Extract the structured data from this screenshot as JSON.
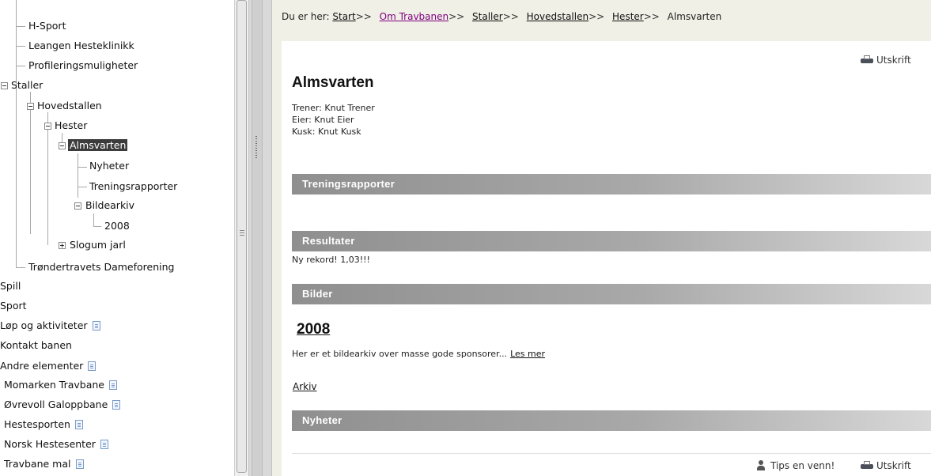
{
  "tree": {
    "items": [
      {
        "label": "H-Sport",
        "has_page_icon": false
      },
      {
        "label": "Leangen Hesteklinikk",
        "has_page_icon": false
      },
      {
        "label": "Profileringsmuligheter",
        "has_page_icon": false
      },
      {
        "label": "Staller",
        "has_page_icon": false
      },
      {
        "label": "Hovedstallen",
        "has_page_icon": false
      },
      {
        "label": "Hester",
        "has_page_icon": false
      },
      {
        "label": "Almsvarten",
        "has_page_icon": false,
        "selected": true
      },
      {
        "label": "Nyheter",
        "has_page_icon": false
      },
      {
        "label": "Treningsrapporter",
        "has_page_icon": false
      },
      {
        "label": "Bildearkiv",
        "has_page_icon": false
      },
      {
        "label": "2008",
        "has_page_icon": false
      },
      {
        "label": "Slogum jarl",
        "has_page_icon": false
      },
      {
        "label": "Trøndertravets Dameforening",
        "has_page_icon": false
      },
      {
        "label": "Spill",
        "has_page_icon": false
      },
      {
        "label": "Sport",
        "has_page_icon": false
      },
      {
        "label": "Løp og aktiviteter",
        "has_page_icon": true
      },
      {
        "label": "Kontakt banen",
        "has_page_icon": false
      },
      {
        "label": "Andre elementer",
        "has_page_icon": true
      },
      {
        "label": "Momarken Travbane",
        "has_page_icon": true
      },
      {
        "label": "Øvrevoll Galoppbane",
        "has_page_icon": true
      },
      {
        "label": "Hestesporten",
        "has_page_icon": true
      },
      {
        "label": "Norsk Hestesenter",
        "has_page_icon": true
      },
      {
        "label": "Travbane mal",
        "has_page_icon": true
      }
    ]
  },
  "breadcrumb": {
    "prefix": "Du er her:",
    "separator": ">>",
    "links": [
      "Start",
      "Om Travbanen",
      "Staller",
      "Hovedstallen",
      "Hester"
    ],
    "current": "Almsvarten"
  },
  "page": {
    "print_label": "Utskrift",
    "title": "Almsvarten",
    "trainer": "Trener: Knut Trener",
    "owner": "Eier: Knut Eier",
    "driver": "Kusk: Knut Kusk",
    "sections": {
      "training": "Treningsrapporter",
      "results": "Resultater",
      "images": "Bilder",
      "news": "Nyheter"
    },
    "result_text": "Ny rekord! 1,03!!!",
    "album_title": "2008",
    "album_desc": "Her er et bildearkiv over masse gode sponsorer...",
    "read_more": "Les mer",
    "archive_link": "Arkiv",
    "tip_friend": "Tips en venn!",
    "footer_print": "Utskrift"
  },
  "colors": {
    "content_bg": "#f0f0e6",
    "selected_bg": "#3c3c3c",
    "section_bar_start": "#8f8f8f",
    "section_bar_end": "#d8d8d8",
    "visited_link": "#800080"
  }
}
